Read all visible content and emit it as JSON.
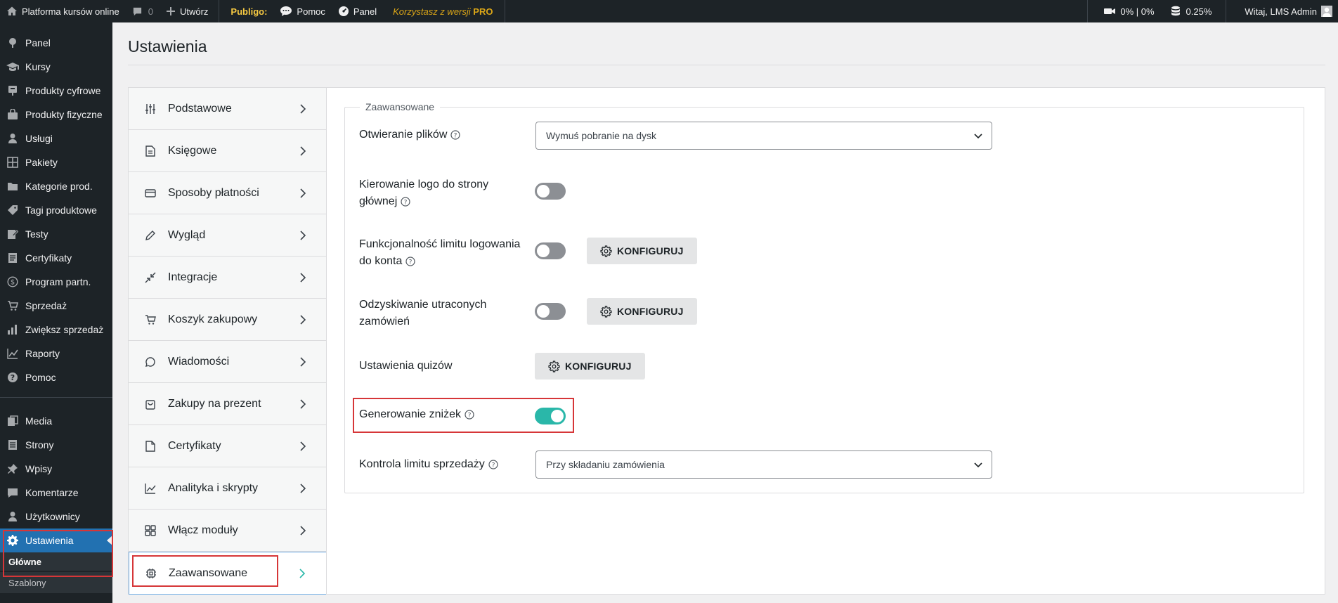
{
  "adminbar": {
    "site_name": "Platforma kursów online",
    "comments_count": "0",
    "new_label": "Utwórz",
    "publigo_label": "Publigo:",
    "help_label": "Pomoc",
    "panel_label": "Panel",
    "pro_text": "Korzystasz z wersji",
    "pro_badge": "PRO",
    "video_stats": "0% | 0%",
    "db_stats": "0.25%",
    "greeting": "Witaj, LMS Admin"
  },
  "sidebar": {
    "items": [
      {
        "label": "Panel",
        "icon": "pin-icon"
      },
      {
        "label": "Kursy",
        "icon": "graduation-cap-icon"
      },
      {
        "label": "Produkty cyfrowe",
        "icon": "plug-icon"
      },
      {
        "label": "Produkty fizyczne",
        "icon": "bag-icon"
      },
      {
        "label": "Usługi",
        "icon": "person-icon"
      },
      {
        "label": "Pakiety",
        "icon": "grid-icon"
      },
      {
        "label": "Kategorie prod.",
        "icon": "folder-icon"
      },
      {
        "label": "Tagi produktowe",
        "icon": "tag-icon"
      },
      {
        "label": "Testy",
        "icon": "edit-icon"
      },
      {
        "label": "Certyfikaty",
        "icon": "document-icon"
      },
      {
        "label": "Program partn.",
        "icon": "dollar-icon"
      },
      {
        "label": "Sprzedaż",
        "icon": "cart-icon"
      },
      {
        "label": "Zwiększ sprzedaż",
        "icon": "bar-chart-icon"
      },
      {
        "label": "Raporty",
        "icon": "line-chart-icon"
      },
      {
        "label": "Pomoc",
        "icon": "help-icon"
      }
    ],
    "items2": [
      {
        "label": "Media",
        "icon": "media-icon"
      },
      {
        "label": "Strony",
        "icon": "pages-icon"
      },
      {
        "label": "Wpisy",
        "icon": "pushpin-icon"
      },
      {
        "label": "Komentarze",
        "icon": "comment-icon"
      },
      {
        "label": "Użytkownicy",
        "icon": "users-icon"
      },
      {
        "label": "Ustawienia",
        "icon": "settings-icon"
      }
    ],
    "submenu": [
      "Główne",
      "Szablony"
    ]
  },
  "page": {
    "title": "Ustawienia"
  },
  "settings_nav": [
    {
      "label": "Podstawowe",
      "icon": "sliders-icon"
    },
    {
      "label": "Księgowe",
      "icon": "file-text-icon"
    },
    {
      "label": "Sposoby płatności",
      "icon": "credit-card-icon"
    },
    {
      "label": "Wygląd",
      "icon": "pencil-icon"
    },
    {
      "label": "Integracje",
      "icon": "arrows-in-icon"
    },
    {
      "label": "Koszyk zakupowy",
      "icon": "cart-icon"
    },
    {
      "label": "Wiadomości",
      "icon": "message-icon"
    },
    {
      "label": "Zakupy na prezent",
      "icon": "gift-bag-icon"
    },
    {
      "label": "Certyfikaty",
      "icon": "file-icon"
    },
    {
      "label": "Analityka i skrypty",
      "icon": "chart-icon"
    },
    {
      "label": "Włącz moduły",
      "icon": "modules-icon"
    },
    {
      "label": "Zaawansowane",
      "icon": "chip-icon"
    }
  ],
  "advanced": {
    "legend": "Zaawansowane",
    "file_opening_label": "Otwieranie plików",
    "file_opening_value": "Wymuś pobranie na dysk",
    "logo_link_label_1": "Kierowanie logo do strony",
    "logo_link_label_2": "głównej",
    "logo_link_enabled": false,
    "login_limit_label_1": "Funkcjonalność limitu logowania",
    "login_limit_label_2": "do konta",
    "login_limit_enabled": false,
    "recovery_label_1": "Odzyskiwanie utraconych",
    "recovery_label_2": "zamówień",
    "recovery_enabled": false,
    "quiz_settings_label": "Ustawienia quizów",
    "configure_label": "KONFIGURUJ",
    "discount_label": "Generowanie zniżek",
    "discount_enabled": true,
    "sales_limit_label": "Kontrola limitu sprzedaży",
    "sales_limit_value": "Przy składaniu zamówienia"
  },
  "colors": {
    "accent": "#2271b1",
    "toggle_on": "#2ab7a9",
    "highlight": "#d63638",
    "adminbar_bg": "#1d2327"
  }
}
